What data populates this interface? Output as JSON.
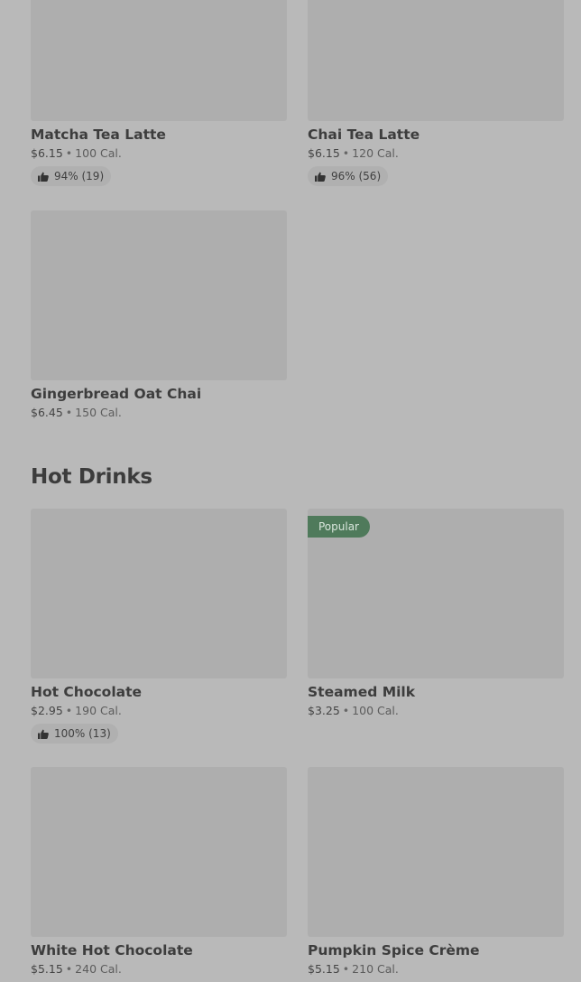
{
  "sections": {
    "hot_drinks_title": "Hot Drinks"
  },
  "items": {
    "matcha": {
      "name": "Matcha Tea Latte",
      "price": "$6.15",
      "cal": "100 Cal.",
      "rating": "94% (19)"
    },
    "chai": {
      "name": "Chai Tea Latte",
      "price": "$6.15",
      "cal": "120 Cal.",
      "rating": "96% (56)"
    },
    "gingerbread": {
      "name": "Gingerbread Oat Chai",
      "price": "$6.45",
      "cal": "150 Cal."
    },
    "hot_chocolate": {
      "name": "Hot Chocolate",
      "price": "$2.95",
      "cal": "190 Cal.",
      "rating": "100% (13)"
    },
    "steamed_milk": {
      "name": "Steamed Milk",
      "price": "$3.25",
      "cal": "100 Cal.",
      "badge": "Popular"
    },
    "white_hot_chocolate": {
      "name": "White Hot Chocolate",
      "price": "$5.15",
      "cal": "240 Cal."
    },
    "pumpkin_spice": {
      "name": "Pumpkin Spice Crème",
      "price": "$5.15",
      "cal": "210 Cal."
    }
  },
  "separator": "•",
  "colors": {
    "background": "#b9b9b9",
    "thumbnail": "#aeaeae",
    "popular_badge": "#4f7a5b"
  },
  "icons": {
    "rating": "thumbs-up-icon"
  }
}
